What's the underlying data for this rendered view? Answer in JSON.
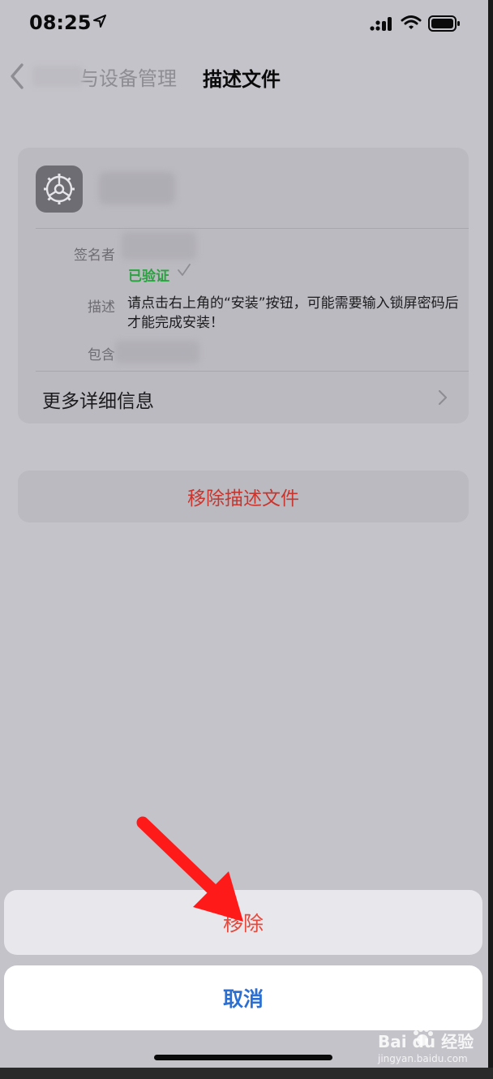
{
  "status_bar": {
    "time": "08:25"
  },
  "nav": {
    "back_label": "与设备管理",
    "title": "描述文件"
  },
  "profile_card": {
    "signer_label": "签名者",
    "verified": "已验证",
    "description_label": "描述",
    "description": "请点击右上角的“安装”按钮，可能需要输入锁屏密码后才能完成安装！",
    "contains_label": "包含",
    "more_details": "更多详细信息"
  },
  "remove_profile_button": "移除描述文件",
  "action_sheet": {
    "remove": "移除",
    "cancel": "取消"
  },
  "watermark": {
    "brand": "Bai du 经验",
    "url": "jingyan.baidu.com"
  },
  "colors": {
    "destructive": "#c7362f",
    "verified": "#29a340",
    "accent": "#2b6fd3",
    "arrow": "#ff1a1a"
  },
  "icons": [
    "location-arrow-icon",
    "signal-icon",
    "wifi-icon",
    "battery-icon",
    "chevron-left-icon",
    "settings-gear-icon",
    "checkmark-icon",
    "chevron-right-icon",
    "red-pointer-arrow"
  ]
}
